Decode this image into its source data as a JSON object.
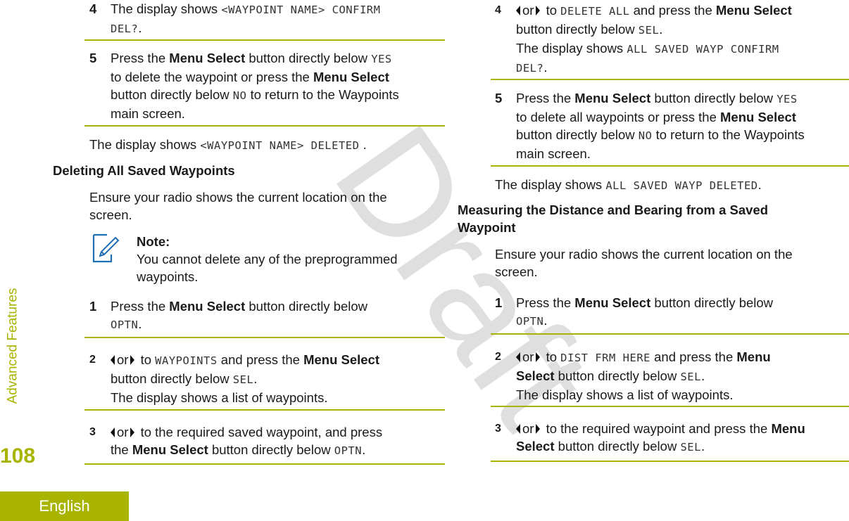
{
  "watermark": "Draft",
  "sidebar": {
    "section_label": "Advanced Features",
    "page_number": "108",
    "language_tab": "English"
  },
  "colors": {
    "accent": "#a8b400",
    "note_icon": "#1f6fb5",
    "watermark": "#d9d9d9"
  },
  "left": {
    "step4": {
      "num": "4",
      "text": "The display shows ",
      "code": "<WAYPOINT NAME> CONFIRM",
      "code2": "DEL?",
      "end": "."
    },
    "step5": {
      "num": "5",
      "t1": "Press the ",
      "b1": "Menu Select",
      "t2": " button directly below ",
      "c1": "YES",
      "t3": "to delete the waypoint or press the ",
      "b2": "Menu Select",
      "t4": "button directly below ",
      "c2": "NO",
      "t5": " to return to the Waypoints",
      "t6": "main screen."
    },
    "result": {
      "text": "The display shows ",
      "code": "<WAYPOINT NAME> DELETED",
      "end": " ."
    },
    "section_heading": "Deleting All Saved Waypoints",
    "intro": {
      "line1": "Ensure your radio shows the current location on the",
      "line2": "screen."
    },
    "note": {
      "title": "Note:",
      "line1": "You cannot delete any of the preprogrammed",
      "line2": "waypoints.",
      "icon": "note-pencil-icon"
    },
    "steps": [
      {
        "num": "1",
        "t1": "Press the ",
        "b1": "Menu Select",
        "t2": " button directly below",
        "c1": "OPTN",
        "end": "."
      },
      {
        "num": "2",
        "or": "or",
        "to": " to ",
        "c1": "WAYPOINTS",
        "t2": " and press the ",
        "b1": "Menu Select",
        "t3": "button directly below ",
        "c2": "SEL",
        "end": ".",
        "t4": "The display shows a list of waypoints."
      },
      {
        "num": "3",
        "or": "or",
        "t1": " to the required saved waypoint, and press",
        "t2": "the ",
        "b1": "Menu Select",
        "t3": " button directly below ",
        "c1": "OPTN",
        "end": "."
      }
    ]
  },
  "right": {
    "step4": {
      "num": "4",
      "or": "or",
      "to": " to ",
      "c1": "DELETE ALL",
      "t1": " and press the ",
      "b1": "Menu Select",
      "t2": "button directly below ",
      "c2": "SEL",
      "end": ".",
      "t3": "The display shows ",
      "c3": "ALL SAVED WAYP CONFIRM",
      "c4": "DEL?",
      "end2": "."
    },
    "step5": {
      "num": "5",
      "t1": "Press the ",
      "b1": "Menu Select",
      "t2": " button directly below ",
      "c1": "YES",
      "t3": "to delete all waypoints or press the ",
      "b2": "Menu Select",
      "t4": "button directly below ",
      "c2": "NO",
      "t5": " to return to the Waypoints",
      "t6": "main screen."
    },
    "result": {
      "text": "The display shows ",
      "code": "ALL SAVED WAYP DELETED",
      "end": "."
    },
    "section_heading_line1": "Measuring the Distance and Bearing from a Saved",
    "section_heading_line2": "Waypoint",
    "intro": {
      "line1": "Ensure your radio shows the current location on the",
      "line2": "screen."
    },
    "steps": [
      {
        "num": "1",
        "t1": "Press the ",
        "b1": "Menu Select",
        "t2": " button directly below",
        "c1": "OPTN",
        "end": "."
      },
      {
        "num": "2",
        "or": "or",
        "to": " to ",
        "c1": "DIST FRM HERE",
        "t1": " and press the ",
        "b1": "Menu",
        "b2": "Select",
        "t2": " button directly below ",
        "c2": "SEL",
        "end": ".",
        "t3": "The display shows a list of waypoints."
      },
      {
        "num": "3",
        "or": "or",
        "t1": " to the required waypoint and press the ",
        "b1": "Menu",
        "b2": "Select",
        "t2": " button directly below ",
        "c1": "SEL",
        "end": "."
      }
    ]
  }
}
